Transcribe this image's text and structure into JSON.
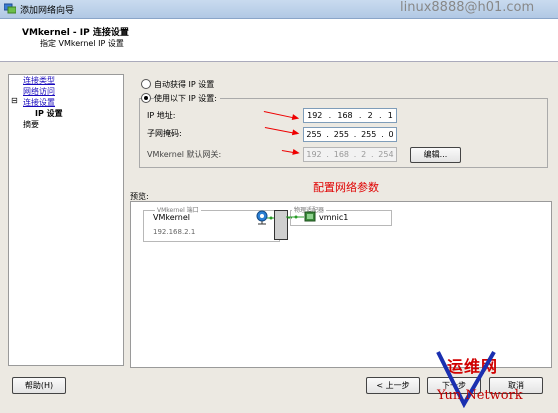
{
  "window": {
    "title": "添加网络向导",
    "watermark_top": "linux8888@h01.com"
  },
  "header": {
    "title": "VMkernel - IP 连接设置",
    "subtitle": "指定 VMkernel IP 设置"
  },
  "nav": {
    "items": [
      {
        "label": "连接类型",
        "link": true
      },
      {
        "label": "网络访问",
        "link": true
      },
      {
        "label": "连接设置",
        "link": true,
        "expander": "⊟"
      },
      {
        "label": "IP 设置",
        "current": true
      },
      {
        "label": "摘要",
        "link": false
      }
    ]
  },
  "ip_settings": {
    "auto_label": "自动获得 IP 设置",
    "manual_label": "使用以下 IP 设置:",
    "ip_label": "IP 地址:",
    "ip_value": [
      "192",
      "168",
      "2",
      "1"
    ],
    "mask_label": "子网掩码:",
    "mask_value": [
      "255",
      "255",
      "255",
      "0"
    ],
    "gateway_label": "VMkernel 默认网关:",
    "gateway_value": [
      "192",
      "168",
      "2",
      "254"
    ],
    "edit_label": "编辑...",
    "annotation": "配置网络参数"
  },
  "preview": {
    "label": "预览:",
    "vmk_group_title": "VMkernel 端口",
    "vmk_name": "VMkernel",
    "vmk_ip": "192.168.2.1",
    "phys_group_title": "物理适配器",
    "nic": "vmnic1"
  },
  "buttons": {
    "help": "帮助(H)",
    "back": "< 上一步",
    "next": "下一步",
    "cancel": "取消"
  },
  "watermark_bottom": {
    "cn": "运维网",
    "en": "Yun Network"
  },
  "colors": {
    "link": "#1a0bbd",
    "annotation": "#e00000",
    "arrow": "#e00000"
  }
}
